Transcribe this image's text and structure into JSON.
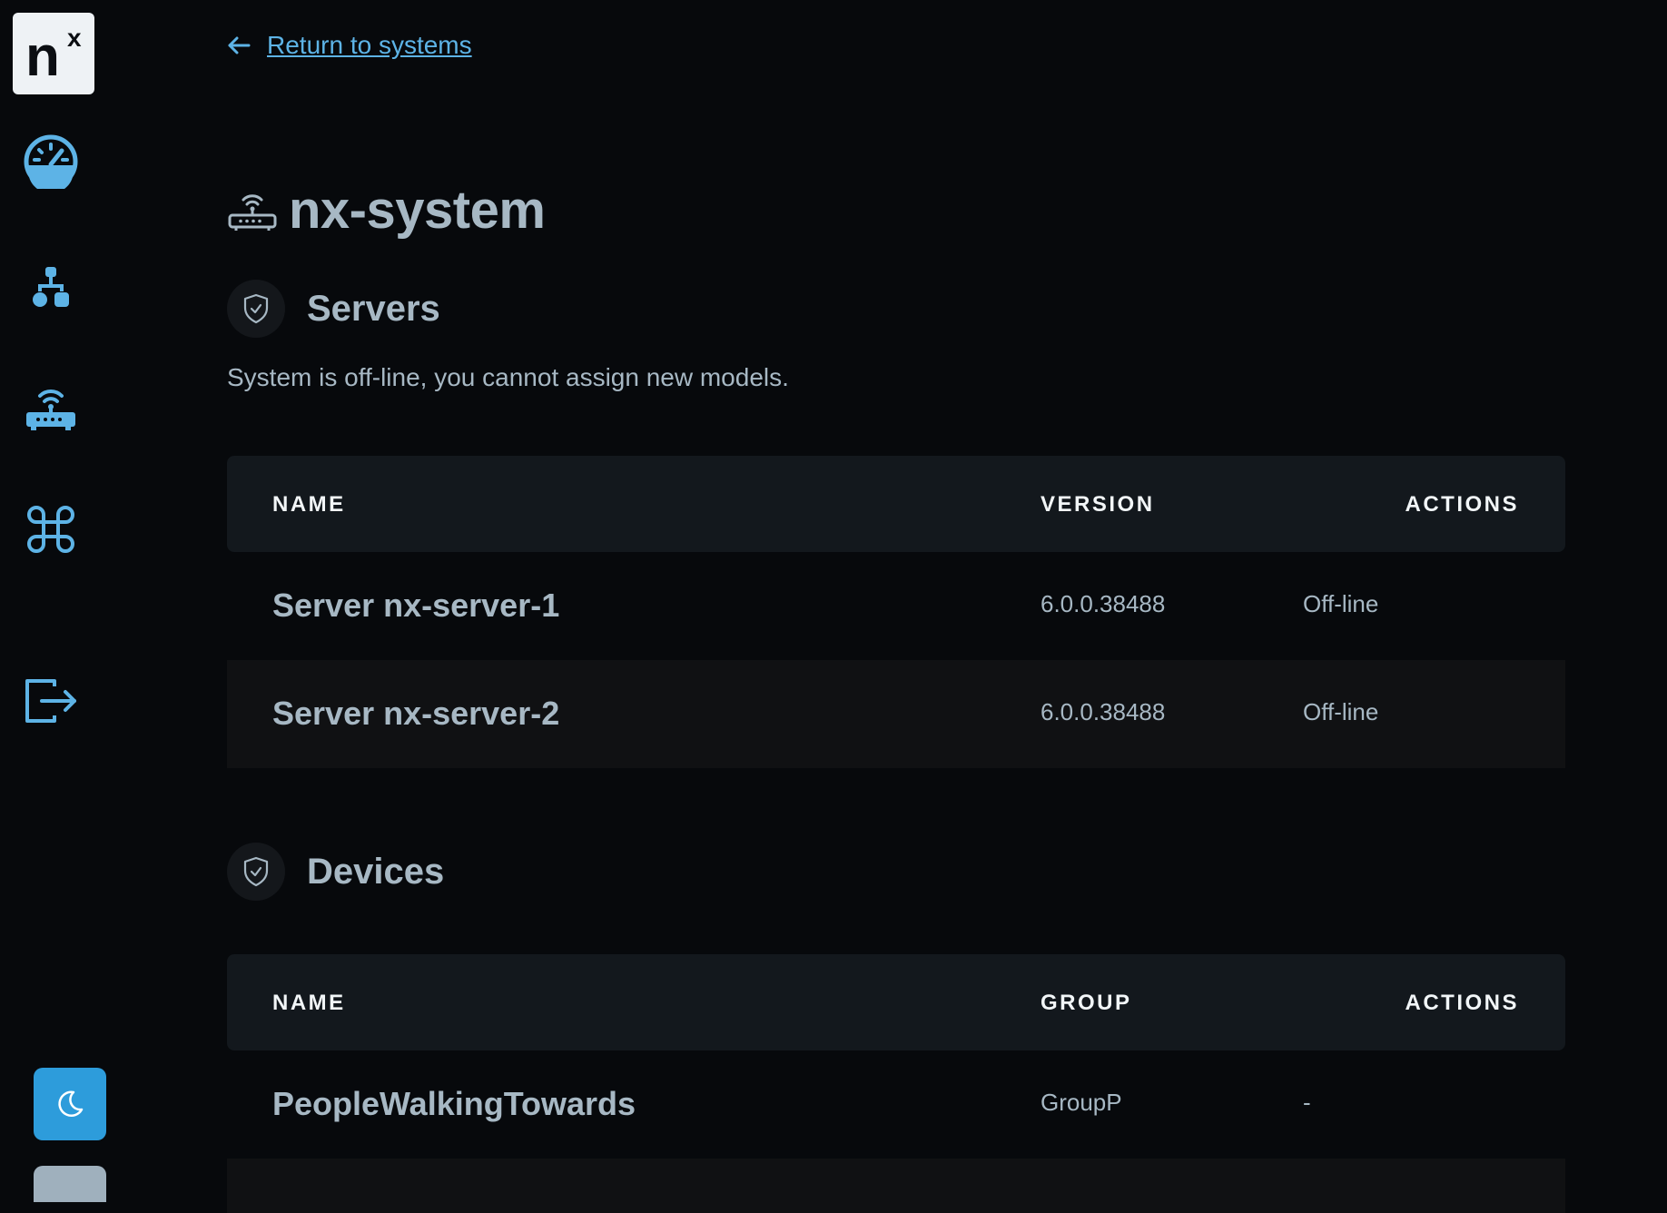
{
  "brand": {
    "logo_main": "n",
    "logo_sup": "x"
  },
  "sidebar": {
    "items": [
      {
        "icon": "dashboard-gauge-icon"
      },
      {
        "icon": "network-hierarchy-icon"
      },
      {
        "icon": "router-icon"
      },
      {
        "icon": "command-icon"
      },
      {
        "icon": "logout-icon"
      }
    ],
    "theme_icon": "moon-icon"
  },
  "nav": {
    "back_label": "Return to systems"
  },
  "system": {
    "name": "nx-system"
  },
  "servers": {
    "title": "Servers",
    "notice": "System is off-line, you cannot assign new models.",
    "columns": [
      "NAME",
      "VERSION",
      "ACTIONS"
    ],
    "rows": [
      {
        "name": "Server nx-server-1",
        "version": "6.0.0.38488",
        "action": "Off-line"
      },
      {
        "name": "Server nx-server-2",
        "version": "6.0.0.38488",
        "action": "Off-line"
      }
    ]
  },
  "devices": {
    "title": "Devices",
    "columns": [
      "NAME",
      "GROUP",
      "ACTIONS"
    ],
    "rows": [
      {
        "name": "PeopleWalkingTowards",
        "group": "GroupP",
        "action": "-"
      }
    ]
  },
  "colors": {
    "accent": "#5db3e6",
    "button": "#2d9cdb",
    "background": "#07090c",
    "header_bg": "#13181d"
  }
}
